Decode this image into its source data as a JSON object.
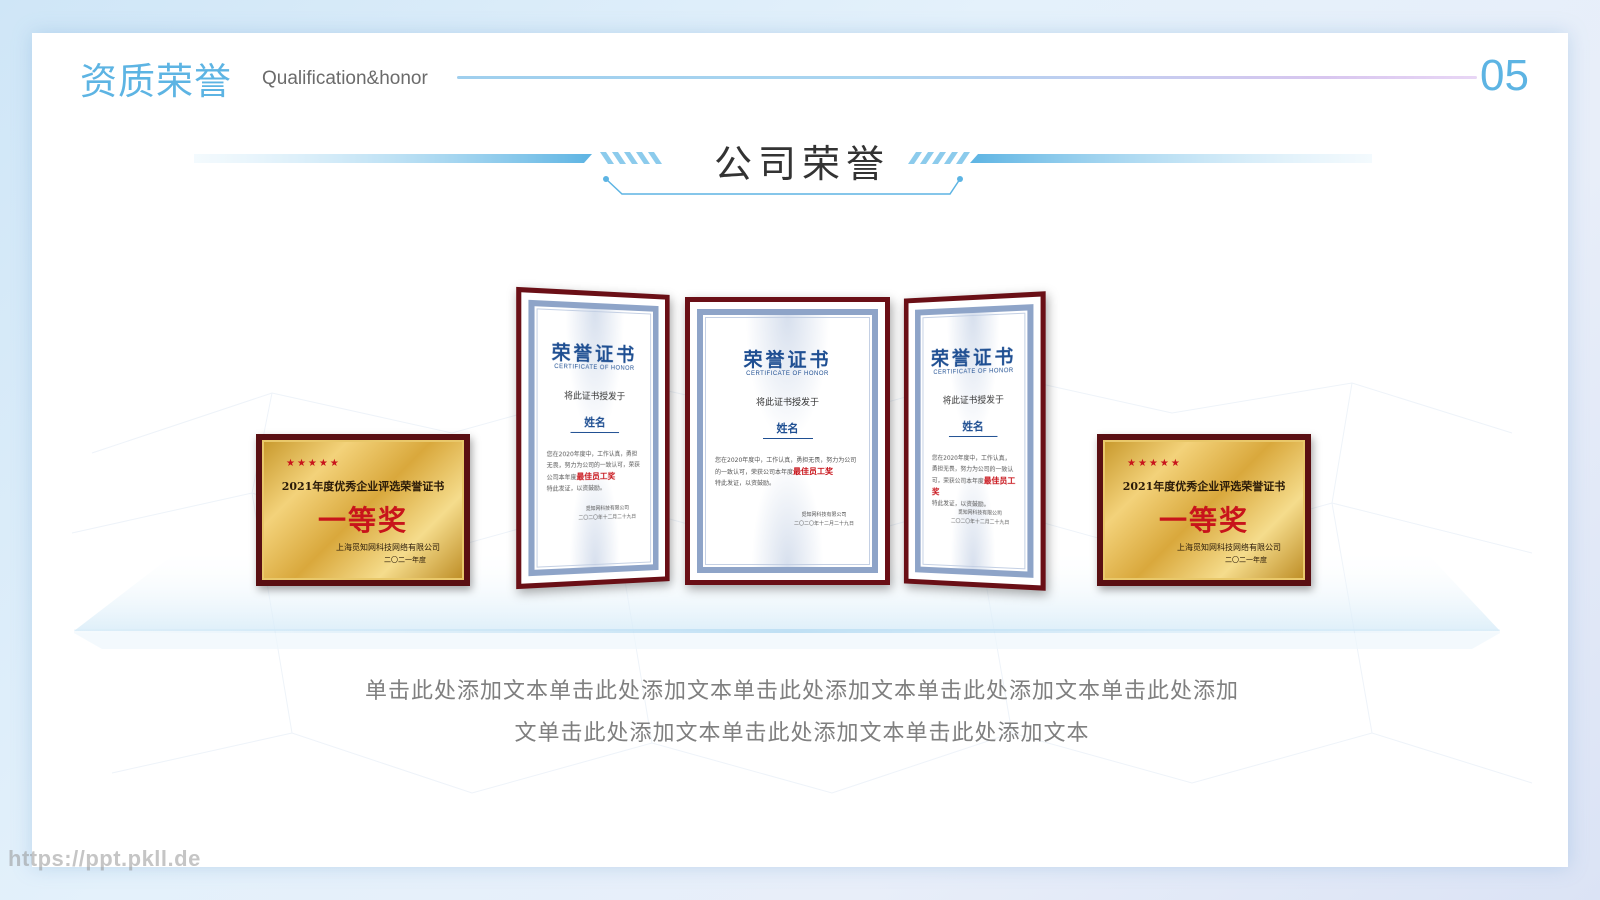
{
  "header": {
    "title": "资质荣誉",
    "subtitle": "Qualification&honor",
    "page_number": "05"
  },
  "section": {
    "title": "公司荣誉"
  },
  "plaques": [
    {
      "stars": "★★★★★",
      "title": "2021年度优秀企业评选荣誉证书",
      "award": "一等奖",
      "company": "上海觅知网科技网络有限公司",
      "year": "二〇二一年度"
    },
    {
      "stars": "★★★★★",
      "title": "2021年度优秀企业评选荣誉证书",
      "award": "一等奖",
      "company": "上海觅知网科技网络有限公司",
      "year": "二〇二一年度"
    }
  ],
  "certificates": [
    {
      "title": "荣誉证书",
      "subtitle": "CERTIFICATE OF HONOR",
      "grant": "将此证书授发于",
      "name": "姓名",
      "body": "您在2020年度中，工作认真，勇担无畏，努力为公司的一致认可，荣获公司本年度",
      "highlight": "最佳员工奖",
      "body_end": "特此发证，以资鼓励。",
      "issuer": "觅知网科技有限公司",
      "date": "二〇二〇年十二月二十九日"
    },
    {
      "title": "荣誉证书",
      "subtitle": "CERTIFICATE OF HONOR",
      "grant": "将此证书授发于",
      "name": "姓名",
      "body": "您在2020年度中，工作认真，勇担无畏，努力为公司的一致认可，荣获公司本年度",
      "highlight": "最佳员工奖",
      "body_end": "特此发证，以资鼓励。",
      "issuer": "觅知网科技有限公司",
      "date": "二〇二〇年十二月二十九日"
    },
    {
      "title": "荣誉证书",
      "subtitle": "CERTIFICATE OF HONOR",
      "grant": "将此证书授发于",
      "name": "姓名",
      "body": "您在2020年度中，工作认真，勇担无畏，努力为公司的一致认可，荣获公司本年度",
      "highlight": "最佳员工奖",
      "body_end": "特此发证，以资鼓励。",
      "issuer": "觅知网科技有限公司",
      "date": "二〇二〇年十二月二十九日"
    }
  ],
  "description": {
    "line1": "单击此处添加文本单击此处添加文本单击此处添加文本单击此处添加文本单击此处添加",
    "line2": "文单击此处添加文本单击此处添加文本单击此处添加文本"
  },
  "watermark": "https://ppt.pkll.de",
  "colors": {
    "accent": "#5db4e3",
    "frame": "#6a0f16",
    "award_red": "#c8141b",
    "text_gray": "#7f7f7f"
  }
}
